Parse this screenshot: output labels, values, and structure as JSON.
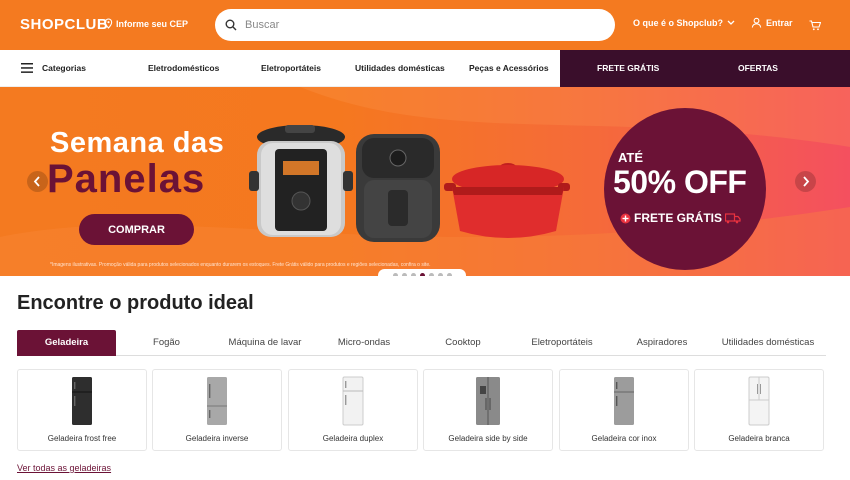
{
  "header": {
    "logo": "SHOPCLUB",
    "cep_label": "Informe seu CEP",
    "search_placeholder": "Buscar",
    "about_label": "O que é o Shopclub?",
    "login_label": "Entrar"
  },
  "nav": {
    "categorias": "Categorias",
    "items": [
      "Eletrodomésticos",
      "Eletroportáteis",
      "Utilidades domésticas",
      "Peças e Acessórios"
    ],
    "highlight_items": [
      "FRETE GRÁTIS",
      "OFERTAS"
    ]
  },
  "banner": {
    "headline_1": "Semana das",
    "headline_2": "Panelas",
    "button": "COMPRAR",
    "disclaimer": "*Imagens ilustrativas. Promoção válida para produtos selecionados enquanto durarem os estoques. Frete Grátis válido para produtos e regiões selecionadas, confira o site.",
    "badge_ate": "ATÉ",
    "badge_off": "50% OFF",
    "badge_frete": "FRETE GRÁTIS",
    "slide_count": 7,
    "active_slide": 4
  },
  "section": {
    "title": "Encontre o produto ideal",
    "tabs": [
      "Geladeira",
      "Fogão",
      "Máquina de lavar",
      "Micro-ondas",
      "Cooktop",
      "Eletroportáteis",
      "Aspiradores",
      "Utilidades domésticas"
    ],
    "cards": [
      "Geladeira frost free",
      "Geladeira inverse",
      "Geladeira duplex",
      "Geladeira side by side",
      "Geladeira cor inox",
      "Geladeira branca"
    ],
    "see_all": "Ver todas as geladeiras"
  },
  "colors": {
    "brand_orange": "#f47a20",
    "brand_wine": "#6b1236",
    "nav_dark": "#3a0e2b"
  }
}
